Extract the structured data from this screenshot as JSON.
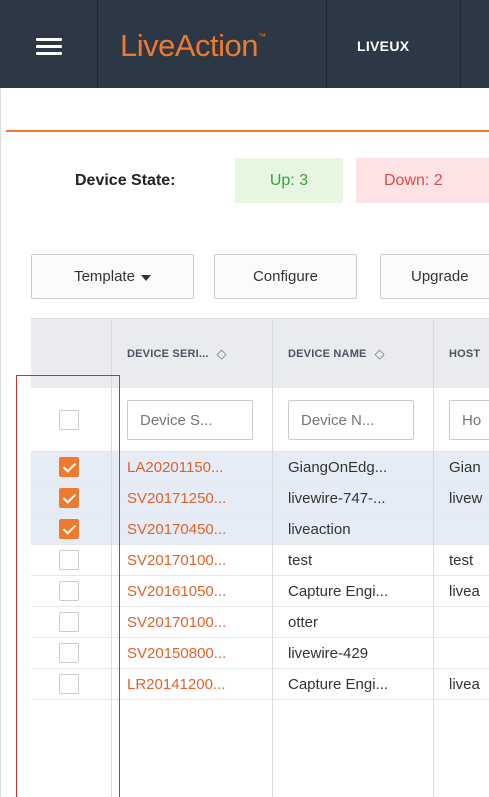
{
  "nav": {
    "logo": "LiveAction",
    "logo_tm": "™",
    "item": "LIVEUX"
  },
  "device_state": {
    "label": "Device State:",
    "up": "Up:  3",
    "down": "Down:  2"
  },
  "toolbar": {
    "template_label": "Template",
    "configure_label": "Configure",
    "upgrade_label": "Upgrade"
  },
  "table": {
    "headers": {
      "serial": "DEVICE SERI...",
      "name": "DEVICE NAME",
      "host": "HOST"
    },
    "filters": {
      "serial_placeholder": "Device S...",
      "name_placeholder": "Device N...",
      "host_placeholder": "Ho"
    },
    "rows": [
      {
        "checked": true,
        "serial": "LA20201150...",
        "name": "GiangOnEdg...",
        "host": "Gian"
      },
      {
        "checked": true,
        "serial": "SV20171250...",
        "name": "livewire-747-...",
        "host": "livew"
      },
      {
        "checked": true,
        "serial": "SV20170450...",
        "name": "liveaction",
        "host": ""
      },
      {
        "checked": false,
        "serial": "SV20170100...",
        "name": "test",
        "host": "test"
      },
      {
        "checked": false,
        "serial": "SV20161050...",
        "name": "Capture Engi...",
        "host": "livea"
      },
      {
        "checked": false,
        "serial": "SV20170100...",
        "name": "otter",
        "host": ""
      },
      {
        "checked": false,
        "serial": "SV20150800...",
        "name": "livewire-429",
        "host": ""
      },
      {
        "checked": false,
        "serial": "LR20141200...",
        "name": "Capture Engi...",
        "host": "livea"
      }
    ]
  },
  "colors": {
    "accent": "#ef7a2f",
    "nav_bg": "#2c3845",
    "up_bg": "#e6f6e1",
    "down_bg": "#fde3e3",
    "annotation": "#e02b2b"
  }
}
